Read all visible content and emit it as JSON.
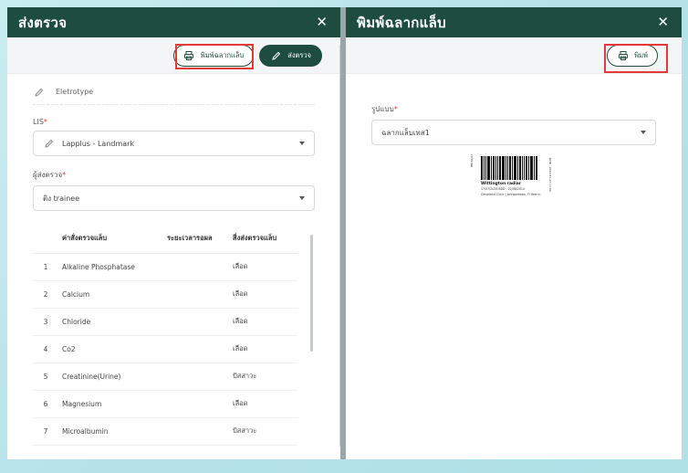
{
  "left_panel": {
    "title": "ส่งตรวจ",
    "close_icon": "close-icon",
    "print_label_button": "พิมพ์ฉลากแล็บ",
    "send_button": "ส่งตรวจ",
    "static_field_value": "Eletrotype",
    "lis": {
      "label": "LIS",
      "value": "Lapplus - Landmark"
    },
    "sender": {
      "label": "ผู้ส่งตรวจ",
      "value": "ติง trainee"
    },
    "table": {
      "headers": [
        "",
        "ค่าสั่งตรวจแล็บ",
        "ระยะเวลารอผล",
        "สิ่งส่งตรวจแล็บ"
      ],
      "rows": [
        {
          "no": "1",
          "test": "Alkaline Phosphatase",
          "wait": "",
          "specimen": "เลือด"
        },
        {
          "no": "2",
          "test": "Calcium",
          "wait": "",
          "specimen": "เลือด"
        },
        {
          "no": "3",
          "test": "Chloride",
          "wait": "",
          "specimen": "เลือด"
        },
        {
          "no": "4",
          "test": "Co2",
          "wait": "",
          "specimen": "เลือด"
        },
        {
          "no": "5",
          "test": "Creatinine(Urine)",
          "wait": "",
          "specimen": "ปัสสาวะ"
        },
        {
          "no": "6",
          "test": "Magnesium",
          "wait": "",
          "specimen": "เลือด"
        },
        {
          "no": "7",
          "test": "Microalbumin",
          "wait": "",
          "specimen": "ปัสสาวะ"
        }
      ]
    }
  },
  "right_panel": {
    "title": "พิมพ์ฉลากแล็บ",
    "print_button": "พิมพ์",
    "format": {
      "label": "รูปแบบ",
      "value": "ฉลากแล็บเทส1"
    },
    "label_preview": {
      "name": "Wittington radiar",
      "line1": "17/07/2024      BDD  :  22/08/2014",
      "line2": "Cleveland Clinic | Johnsontown, FI   ปัสสาวะ",
      "side_left": "HN 60/23",
      "side_right": "DOB : 2023-07-23 11:00"
    }
  },
  "colors": {
    "header": "#1e4d3f",
    "highlight": "#e53935"
  }
}
